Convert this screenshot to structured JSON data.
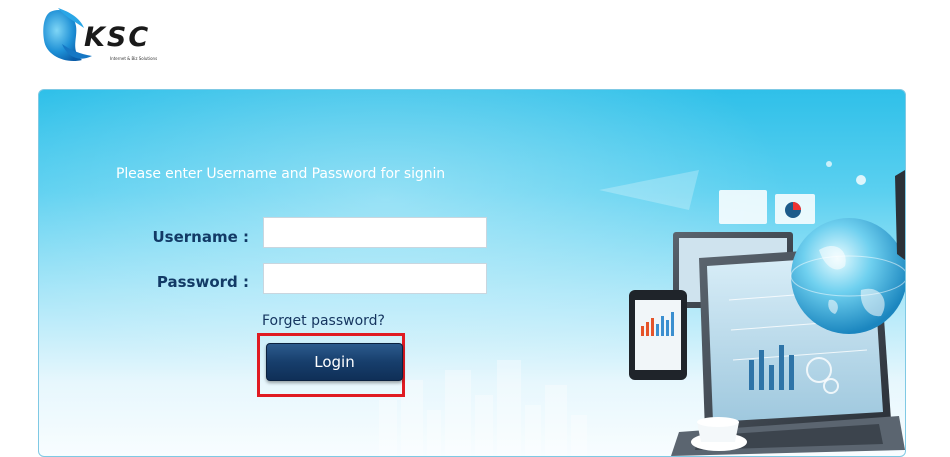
{
  "logo": {
    "text": "KSC",
    "tagline": "Internet & Biz Solutions"
  },
  "login": {
    "prompt": "Please enter Username and Password for signin",
    "username_label": "Username :",
    "password_label": "Password :",
    "username_value": "",
    "password_value": "",
    "forgot_link": "Forget password?",
    "login_button": "Login"
  },
  "colors": {
    "panel_top": "#2fc0e9",
    "label_text": "#123a66",
    "button_bg": "#173e6c",
    "highlight": "#e01b22"
  },
  "icons": [
    "ksc-logo-icon",
    "computer-illustration"
  ]
}
